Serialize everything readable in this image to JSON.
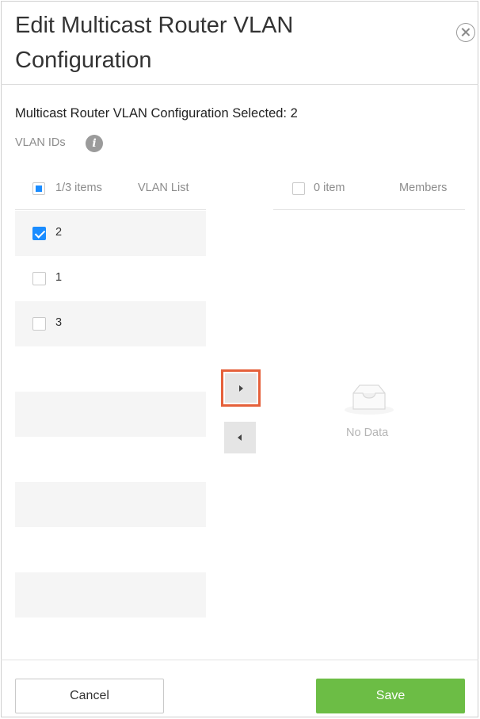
{
  "dialog": {
    "title": "Edit Multicast Router VLAN Configuration",
    "selected_text": "Multicast Router VLAN Configuration Selected: 2",
    "field_label": "VLAN IDs",
    "info_glyph": "i"
  },
  "transfer": {
    "left": {
      "count_label": "1/3 items",
      "title": "VLAN List",
      "select_all_state": "indeterminate",
      "items": [
        {
          "label": "2",
          "checked": true
        },
        {
          "label": "1",
          "checked": false
        },
        {
          "label": "3",
          "checked": false
        }
      ]
    },
    "right": {
      "count_label": "0 item",
      "title": "Members",
      "empty_text": "No Data"
    },
    "move_right_icon": "caret-right-icon",
    "move_left_icon": "caret-left-icon"
  },
  "footer": {
    "cancel_label": "Cancel",
    "save_label": "Save"
  },
  "colors": {
    "checkbox_blue": "#1a8cff",
    "save_green": "#6cbd45",
    "highlight_orange": "#e5603a"
  }
}
